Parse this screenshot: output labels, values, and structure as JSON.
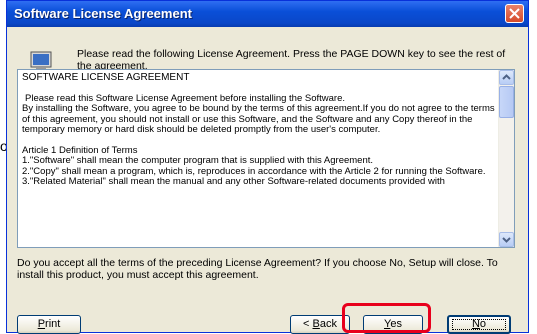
{
  "window": {
    "title": "Software License Agreement"
  },
  "header": {
    "text": "Please read the following License Agreement. Press the PAGE DOWN key to see the rest of the agreement."
  },
  "license": {
    "title": "SOFTWARE LICENSE AGREEMENT",
    "para1": "Please read this Software License Agreement before installing the Software.",
    "para2": "By installing the Software, you agree to be bound by the terms of this agreement.If you do not agree to the terms of this agreement, you should not install or use this Software, and the Software and any Copy thereof in the temporary memory or hard disk should be deleted promptly from the user's computer.",
    "article1": "Article 1 Definition of Terms",
    "term1": "1.\"Software\" shall mean the computer program that is supplied with this Agreement.",
    "term2": "2.\"Copy\" shall mean a program, which is, reproduces in accordance with the Article 2 for running the Software.",
    "term3": "3.\"Related Material\"  shall mean the manual and any other Software-related documents provided with"
  },
  "question": {
    "text": "Do you accept all the terms of the preceding License Agreement? If you choose No, Setup will close. To install this product, you must accept this agreement."
  },
  "buttons": {
    "print": {
      "label_prefix": "",
      "accel": "P",
      "label_rest": "rint"
    },
    "back": {
      "label_prefix": "< ",
      "accel": "B",
      "label_rest": "ack"
    },
    "yes": {
      "label_prefix": "",
      "accel": "Y",
      "label_rest": "es"
    },
    "no": {
      "label_prefix": "",
      "accel": "N",
      "label_rest": "o"
    }
  },
  "left_edge_char": "o",
  "colors": {
    "highlight": "#e8001c",
    "titlebar": "#0a4fd8"
  }
}
